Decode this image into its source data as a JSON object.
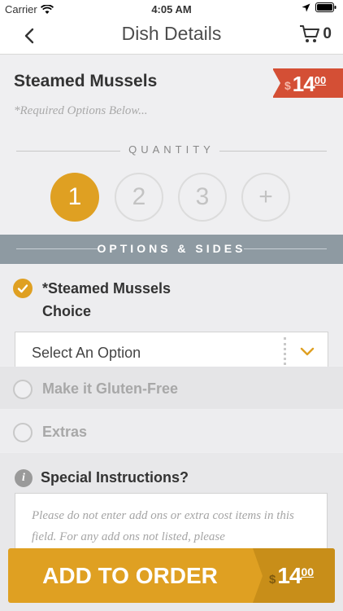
{
  "status_bar": {
    "carrier": "Carrier",
    "time": "4:05 AM"
  },
  "nav": {
    "title": "Dish Details",
    "cart_count": "0"
  },
  "dish": {
    "name": "Steamed Mussels",
    "price": {
      "currency": "$",
      "whole": "14",
      "cents": "00"
    },
    "required_note": "*Required Options Below..."
  },
  "quantity": {
    "label": "QUANTITY",
    "options": [
      "1",
      "2",
      "3",
      "+"
    ],
    "selected": "1"
  },
  "options_header": "OPTIONS & SIDES",
  "options": [
    {
      "label": "*Steamed Mussels Choice",
      "checked": true,
      "select_value": "Select An Option"
    },
    {
      "label": "Make it Gluten-Free",
      "checked": false
    },
    {
      "label": "Extras",
      "checked": false
    }
  ],
  "special_instructions": {
    "title": "Special Instructions?",
    "placeholder": "Please do not enter add ons or extra cost items in this field. For any add ons not listed, please"
  },
  "add_button": {
    "label": "ADD TO ORDER",
    "price": {
      "currency": "$",
      "whole": "14",
      "cents": "00"
    }
  },
  "colors": {
    "accent": "#dfa022",
    "price_tag": "#d44f35",
    "section_header": "#8e9aa2"
  }
}
